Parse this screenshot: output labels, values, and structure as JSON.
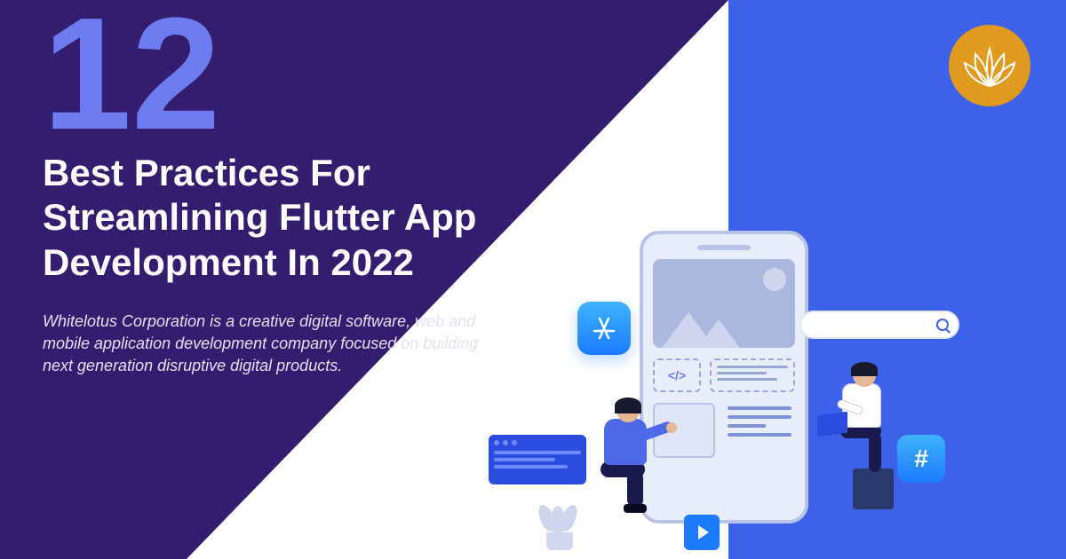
{
  "number": "12",
  "headline": "Best Practices For Streamlining Flutter App Development In 2022",
  "subtext": "Whitelotus Corporation is a creative digital software, web and mobile application development company focused on building next generation disruptive digital products.",
  "icons": {
    "code": "</>",
    "hash": "#"
  }
}
